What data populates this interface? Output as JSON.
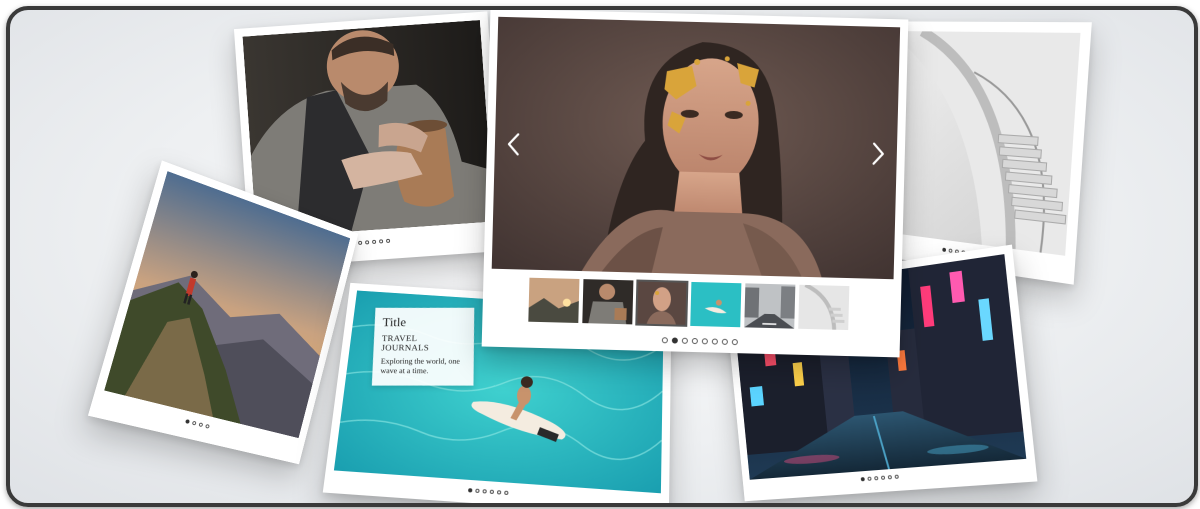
{
  "scene": {
    "description_free": true
  },
  "featured_slider": {
    "prev_icon": "chevron-left-icon",
    "next_icon": "chevron-right-icon",
    "thumbnails": [
      "mountain-sunset-thumb",
      "potter-thumb",
      "gold-makeup-thumb",
      "surfer-thumb",
      "city-street-thumb",
      "spiral-stairs-thumb"
    ],
    "active_thumbnail": 3,
    "dots_total": 8,
    "active_dot": 2
  },
  "caption_card": {
    "title": "Title",
    "subtitle": "TRAVEL JOURNALS",
    "body": "Exploring the world, one wave at a time."
  },
  "cards": {
    "potter": {
      "dots_total": 6,
      "active_dot": 1
    },
    "mountain": {
      "dots_total": 4,
      "active_dot": 1
    },
    "surfer": {
      "dots_total": 6,
      "active_dot": 1
    },
    "stairs": {
      "dots_total": 5,
      "active_dot": 1
    },
    "city": {
      "dots_total": 6,
      "active_dot": 1
    }
  },
  "colors": {
    "frame_border": "#3a3a3a",
    "background": "#eef0f2",
    "card": "#ffffff",
    "dot_active": "#333333"
  }
}
